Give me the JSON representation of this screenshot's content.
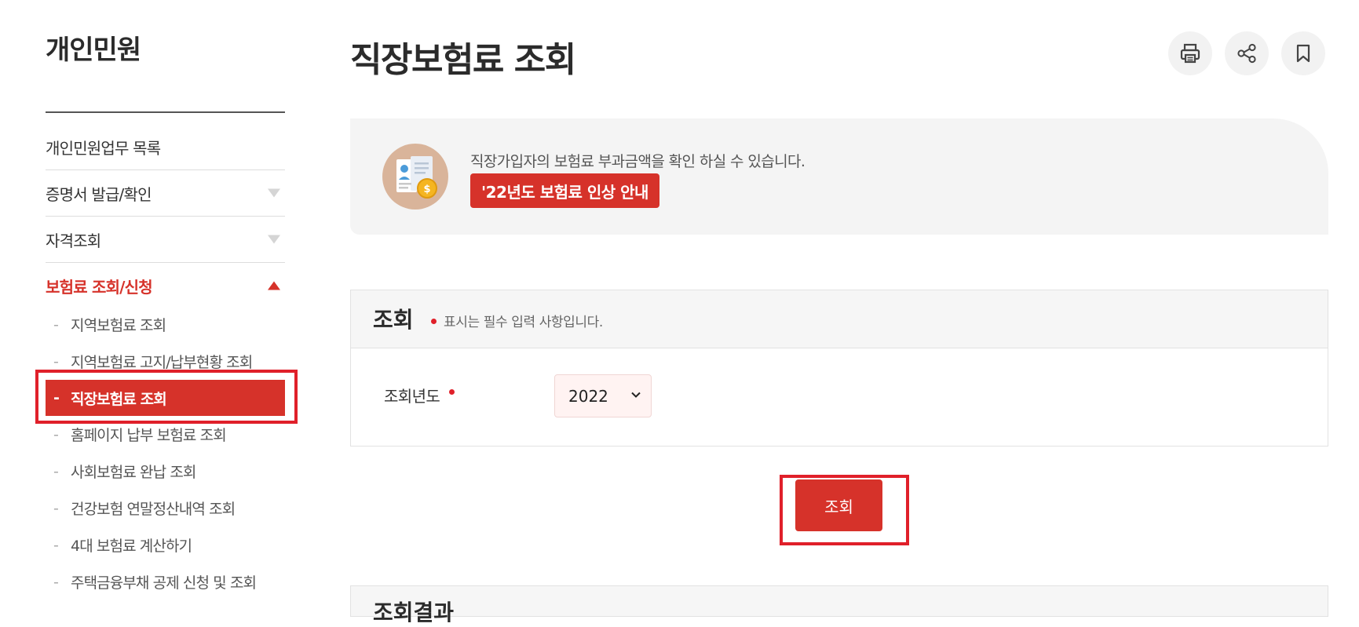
{
  "sidebar": {
    "title": "개인민원",
    "menu": [
      {
        "label": "개인민원업무 목록"
      },
      {
        "label": "증명서 발급/확인"
      },
      {
        "label": "자격조회"
      },
      {
        "label": "보험료 조회/신청"
      }
    ],
    "submenu": [
      {
        "dash": "-",
        "label": "지역보험료 조회"
      },
      {
        "dash": "-",
        "label": "지역보험료 고지/납부현황 조회"
      },
      {
        "dash": "-",
        "label": "직장보험료 조회"
      },
      {
        "dash": "-",
        "label": "홈페이지 납부 보험료 조회"
      },
      {
        "dash": "-",
        "label": "사회보험료 완납 조회"
      },
      {
        "dash": "-",
        "label": "건강보험 연말정산내역 조회"
      },
      {
        "dash": "-",
        "label": "4대 보험료 계산하기"
      },
      {
        "dash": "-",
        "label": "주택금융부채 공제 신청 및 조회"
      }
    ]
  },
  "header": {
    "title": "직장보험료 조회",
    "actions": [
      "printer-icon",
      "share-icon",
      "bookmark-icon"
    ]
  },
  "notice": {
    "text": "직장가입자의 보험료 부과금액을 확인 하실 수 있습니다.",
    "badge": "'22년도 보험료 인상 안내"
  },
  "form": {
    "title": "조회",
    "required_note": "표시는 필수 입력 사항입니다.",
    "year_label": "조회년도",
    "year_value": "2022"
  },
  "search_button": "조회",
  "result": {
    "title": "조회결과"
  },
  "colors": {
    "accent": "#d6322a",
    "highlight": "#e0202a"
  }
}
